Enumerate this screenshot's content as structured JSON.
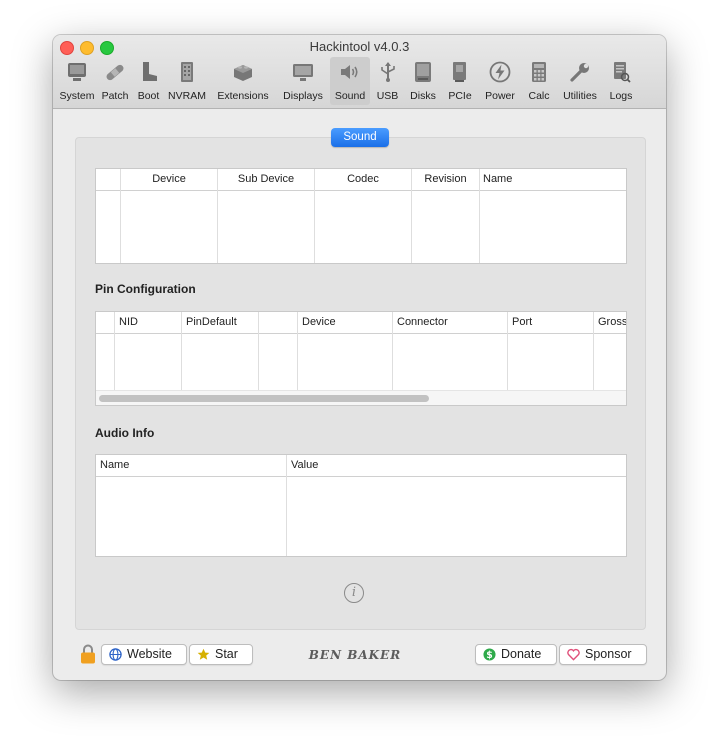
{
  "window": {
    "title": "Hackintool v4.0.3"
  },
  "toolbar": {
    "items": [
      {
        "label": "System",
        "icon": "system-icon"
      },
      {
        "label": "Patch",
        "icon": "bandage-icon"
      },
      {
        "label": "Boot",
        "icon": "boot-icon"
      },
      {
        "label": "NVRAM",
        "icon": "nvram-chip-icon"
      },
      {
        "label": "Extensions",
        "icon": "lego-brick-icon"
      },
      {
        "label": "Displays",
        "icon": "display-icon"
      },
      {
        "label": "Sound",
        "icon": "speaker-icon"
      },
      {
        "label": "USB",
        "icon": "usb-icon"
      },
      {
        "label": "Disks",
        "icon": "disk-icon"
      },
      {
        "label": "PCIe",
        "icon": "pcie-card-icon"
      },
      {
        "label": "Power",
        "icon": "power-bolt-icon"
      },
      {
        "label": "Calc",
        "icon": "calculator-icon"
      },
      {
        "label": "Utilities",
        "icon": "wrench-icon"
      },
      {
        "label": "Logs",
        "icon": "logs-icon"
      }
    ],
    "selected": "Sound"
  },
  "tab": {
    "label": "Sound"
  },
  "sound_table": {
    "columns": [
      "",
      "Device",
      "Sub Device",
      "Codec",
      "Revision",
      "Name"
    ]
  },
  "pin_config": {
    "title": "Pin Configuration",
    "columns": [
      "",
      "NID",
      "PinDefault",
      "",
      "Device",
      "Connector",
      "Port",
      "Gross"
    ]
  },
  "audio_info": {
    "title": "Audio Info",
    "columns": [
      "Name",
      "Value"
    ]
  },
  "footer": {
    "website_label": "Website",
    "star_label": "Star",
    "brand": "BEN BAKER",
    "donate_label": "Donate",
    "sponsor_label": "Sponsor"
  },
  "colors": {
    "accent": "#1a6fe8",
    "lock": "#f0a020",
    "donate": "#2eaa4a",
    "sponsor": "#e0507a",
    "star": "#d6b000"
  }
}
